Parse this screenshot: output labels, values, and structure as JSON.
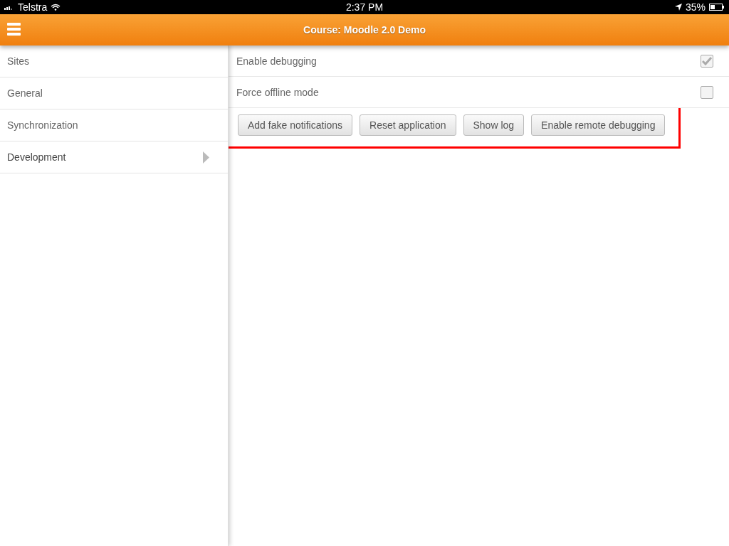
{
  "status_bar": {
    "carrier": "Telstra",
    "time": "2:37 PM",
    "battery": "35%"
  },
  "header": {
    "title": "Course: Moodle 2.0 Demo"
  },
  "sidebar": {
    "items": [
      {
        "label": "Sites",
        "selected": false
      },
      {
        "label": "General",
        "selected": false
      },
      {
        "label": "Synchronization",
        "selected": false
      },
      {
        "label": "Development",
        "selected": true
      }
    ]
  },
  "settings": [
    {
      "label": "Enable debugging",
      "checked": true
    },
    {
      "label": "Force offline mode",
      "checked": false
    }
  ],
  "buttons": [
    "Add fake notifications",
    "Reset application",
    "Show log",
    "Enable remote debugging"
  ],
  "highlight": true
}
